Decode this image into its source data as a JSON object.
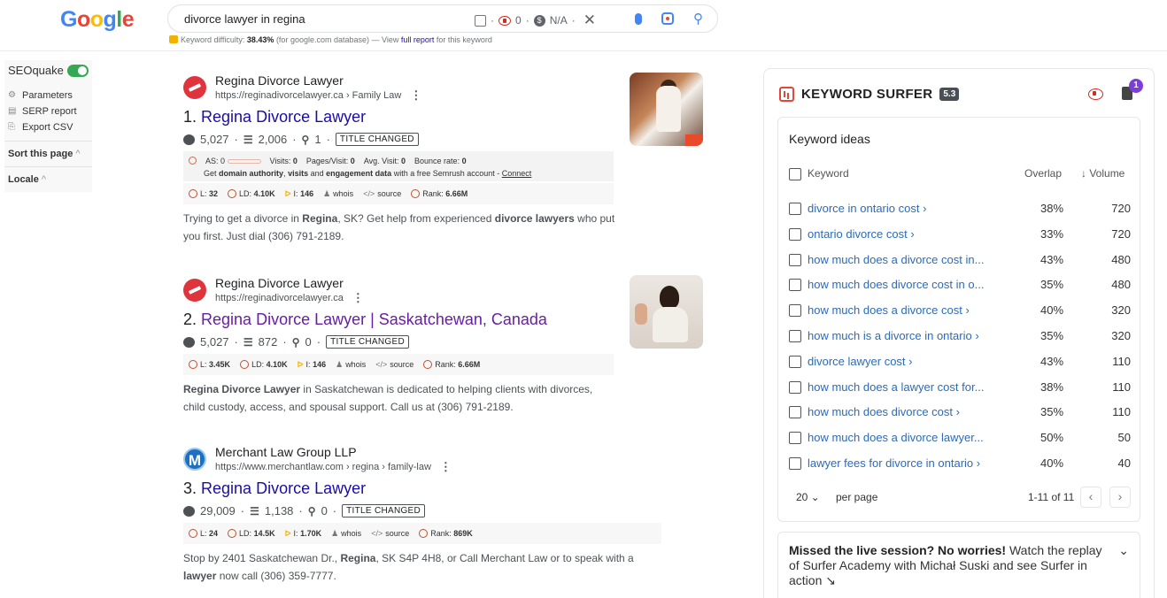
{
  "header": {
    "logo": "Google",
    "query": "divorce lawyer in regina",
    "tools": {
      "flag_count": "0",
      "na": "N/A"
    },
    "kd": {
      "label": "Keyword difficulty:",
      "value": "38.43%",
      "db": "(for google.com database) — View",
      "link": "full report",
      "tail": "for this keyword"
    }
  },
  "seoquake": {
    "title": "SEOquake",
    "links": [
      "Parameters",
      "SERP report",
      "Export CSV"
    ],
    "sort": "Sort this page",
    "locale": "Locale"
  },
  "results": [
    {
      "site": "Regina Divorce Lawyer",
      "url": "https://reginadivorcelawyer.ca › Family Law",
      "num": "1.",
      "title": "Regina Divorce Lawyer",
      "m1": "5,027",
      "m2": "2,006",
      "m3": "1",
      "tag": "TITLE CHANGED",
      "sem": {
        "as": "AS: 0",
        "visits": "Visits:",
        "visits_v": "0",
        "ppv": "Pages/Visit:",
        "ppv_v": "0",
        "avg": "Avg. Visit:",
        "avg_v": "0",
        "br": "Bounce rate:",
        "br_v": "0",
        "sub_pre": "Get",
        "sub_b1": "domain authority",
        "sub_c": ",",
        "sub_b2": "visits",
        "sub_and": "and",
        "sub_b3": "engagement data",
        "sub_mid": "with a free Semrush account -",
        "sub_link": "Connect"
      },
      "bot": {
        "l": "L:",
        "l_v": "32",
        "ld": "LD:",
        "ld_v": "4.10K",
        "i": "I:",
        "i_v": "146",
        "whois": "whois",
        "source": "source",
        "rank": "Rank:",
        "rank_v": "6.66M"
      },
      "snip": [
        "Trying to get a divorce in ",
        "Regina",
        ", SK? Get help from experienced ",
        "divorce lawyers",
        " who put you first. Just dial (306) 791-2189."
      ]
    },
    {
      "site": "Regina Divorce Lawyer",
      "url": "https://reginadivorcelawyer.ca",
      "num": "2.",
      "title": "Regina Divorce Lawyer | Saskatchewan, Canada",
      "m1": "5,027",
      "m2": "872",
      "m3": "0",
      "tag": "TITLE CHANGED",
      "bot": {
        "l": "L:",
        "l_v": "3.45K",
        "ld": "LD:",
        "ld_v": "4.10K",
        "i": "I:",
        "i_v": "146",
        "whois": "whois",
        "source": "source",
        "rank": "Rank:",
        "rank_v": "6.66M"
      },
      "snip": [
        "Regina Divorce Lawyer",
        " in Saskatchewan is dedicated to helping clients with divorces, child custody, access, and spousal support. Call us at (306) 791-2189."
      ]
    },
    {
      "site": "Merchant Law Group LLP",
      "url": "https://www.merchantlaw.com › regina › family-law",
      "fav": "M",
      "num": "3.",
      "title": "Regina Divorce Lawyer",
      "m1": "29,009",
      "m2": "1,138",
      "m3": "0",
      "tag": "TITLE CHANGED",
      "bot": {
        "l": "L:",
        "l_v": "24",
        "ld": "LD:",
        "ld_v": "14.5K",
        "i": "I:",
        "i_v": "1.70K",
        "whois": "whois",
        "source": "source",
        "rank": "Rank:",
        "rank_v": "869K"
      },
      "snip": [
        "Stop by 2401 Saskatchewan Dr., ",
        "Regina",
        ", SK S4P 4H8, or Call Merchant Law or to speak with a ",
        "lawyer",
        " now call (306) 359-7777."
      ]
    }
  ],
  "surfer": {
    "title": "KEYWORD SURFER",
    "version": "5.3",
    "badge": "1",
    "ideas_title": "Keyword ideas",
    "col_keyword": "Keyword",
    "col_overlap": "Overlap",
    "col_volume": "↓ Volume",
    "rows": [
      {
        "kw": "divorce in ontario cost ›",
        "ov": "38%",
        "vol": "720"
      },
      {
        "kw": "ontario divorce cost ›",
        "ov": "33%",
        "vol": "720"
      },
      {
        "kw": "how much does a divorce cost in...",
        "ov": "43%",
        "vol": "480"
      },
      {
        "kw": "how much does divorce cost in o...",
        "ov": "35%",
        "vol": "480"
      },
      {
        "kw": "how much does a divorce cost ›",
        "ov": "40%",
        "vol": "320"
      },
      {
        "kw": "how much is a divorce in ontario ›",
        "ov": "35%",
        "vol": "320"
      },
      {
        "kw": "divorce lawyer cost ›",
        "ov": "43%",
        "vol": "110"
      },
      {
        "kw": "how much does a lawyer cost for...",
        "ov": "38%",
        "vol": "110"
      },
      {
        "kw": "how much does divorce cost ›",
        "ov": "35%",
        "vol": "110"
      },
      {
        "kw": "how much does a divorce lawyer...",
        "ov": "50%",
        "vol": "50"
      },
      {
        "kw": "lawyer fees for divorce in ontario ›",
        "ov": "40%",
        "vol": "40"
      }
    ],
    "per_page_value": "20 ⌄",
    "per_page_label": "per page",
    "range": "1-11 of 11",
    "missed_bold": "Missed the live session? No worries!",
    "missed_rest": " Watch the replay of Surfer Academy with Michał Suski and see Surfer in action ↘"
  }
}
